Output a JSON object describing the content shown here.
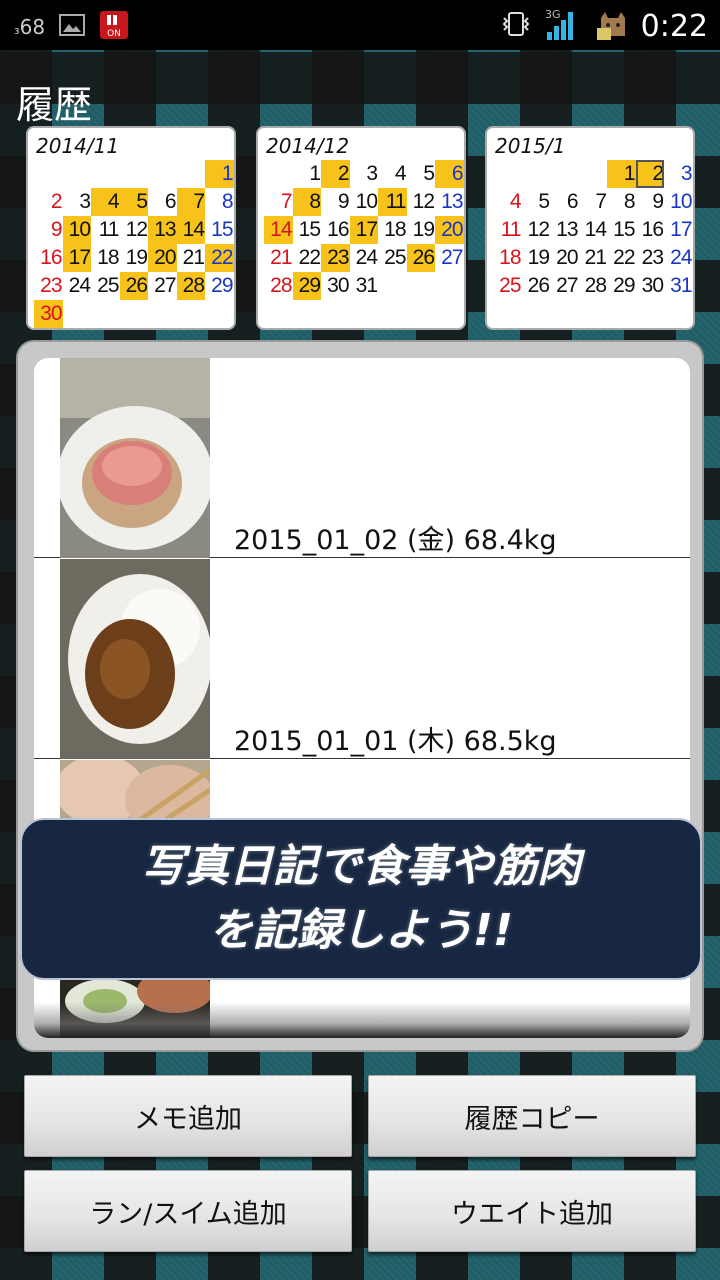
{
  "status_bar": {
    "signal_left": "68",
    "clock": "0:22",
    "network": "3G",
    "icons": [
      "signal-strength-icon",
      "image-icon",
      "uniqlo-on-icon",
      "vibrate-icon",
      "network-bars-icon",
      "cat-icon"
    ]
  },
  "page_title": "履歴",
  "calendars": [
    {
      "title": "2014/11",
      "lead_blanks": 6,
      "days": 30,
      "highlighted": [
        1,
        4,
        5,
        7,
        10,
        13,
        14,
        17,
        20,
        22,
        26,
        28,
        30
      ],
      "today": null
    },
    {
      "title": "2014/12",
      "lead_blanks": 1,
      "days": 31,
      "highlighted": [
        2,
        6,
        8,
        11,
        14,
        17,
        20,
        23,
        26,
        29
      ],
      "today": null
    },
    {
      "title": "2015/1",
      "lead_blanks": 4,
      "days": 31,
      "highlighted": [
        1,
        2
      ],
      "today": 2
    }
  ],
  "entries": [
    {
      "label": "2015_01_02 (金) 68.4kg",
      "photo": "roast-beef"
    },
    {
      "label": "2015_01_01 (木) 68.5kg",
      "photo": "curry-rice"
    },
    {
      "label": "",
      "photo": "skewers"
    },
    {
      "label": "",
      "photo": "salad"
    }
  ],
  "banner": {
    "line1": "写真日記で食事や筋肉",
    "line2": "を記録しよう!!"
  },
  "buttons": {
    "memo_add": "メモ追加",
    "history_copy": "履歴コピー",
    "run_swim_add": "ラン/スイム追加",
    "weight_add": "ウエイト追加"
  },
  "colors": {
    "sunday": "#d8141c",
    "saturday": "#1a37c4",
    "highlight": "#f7c21a",
    "banner_bg": "#172741"
  }
}
